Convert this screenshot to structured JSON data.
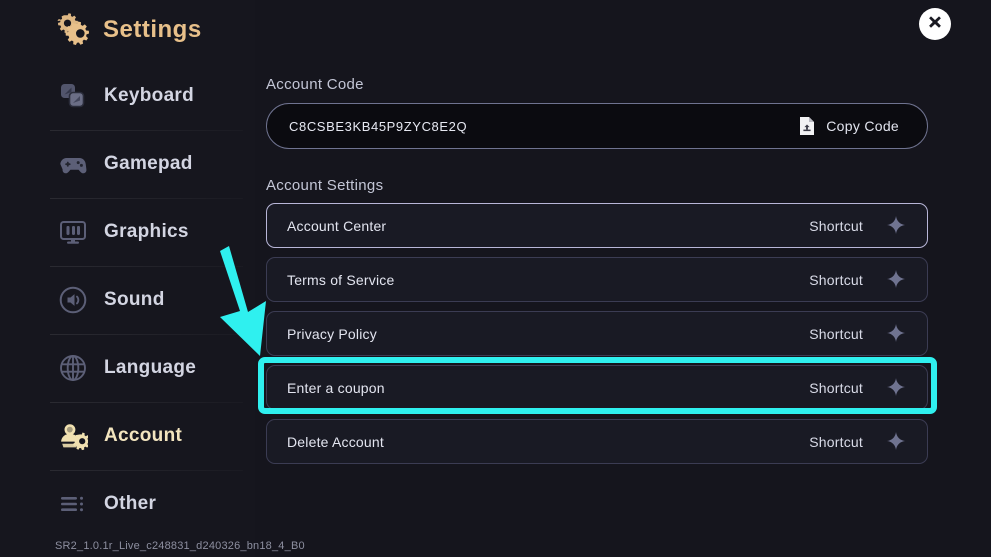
{
  "app": {
    "title": "Settings",
    "version": "SR2_1.0.1r_Live_c248831_d240326_bn18_4_B0",
    "accent_gold": "#e8c08a",
    "background": "#15151d",
    "highlight_cyan": "#2ff0ef"
  },
  "close_button": {
    "label": "Close",
    "icon": "close-icon"
  },
  "sidebar": {
    "items": [
      {
        "label": "Keyboard",
        "icon": "keyboard-icon",
        "active": false
      },
      {
        "label": "Gamepad",
        "icon": "gamepad-icon",
        "active": false
      },
      {
        "label": "Graphics",
        "icon": "graphics-icon",
        "active": false
      },
      {
        "label": "Sound",
        "icon": "sound-icon",
        "active": false
      },
      {
        "label": "Language",
        "icon": "language-icon",
        "active": false
      },
      {
        "label": "Account",
        "icon": "account-icon",
        "active": true
      },
      {
        "label": "Other",
        "icon": "other-icon",
        "active": false
      }
    ]
  },
  "main": {
    "account_code": {
      "label": "Account Code",
      "value": "C8CSBE3KB45P9ZYC8E2Q",
      "copy_label": "Copy Code",
      "copy_icon": "copy-document-icon"
    },
    "account_settings": {
      "label": "Account Settings",
      "rows": [
        {
          "label": "Account Center",
          "action": "Shortcut",
          "selected": true,
          "highlighted": false
        },
        {
          "label": "Terms of Service",
          "action": "Shortcut",
          "selected": false,
          "highlighted": false
        },
        {
          "label": "Privacy Policy",
          "action": "Shortcut",
          "selected": false,
          "highlighted": false
        },
        {
          "label": "Enter a coupon",
          "action": "Shortcut",
          "selected": false,
          "highlighted": true
        },
        {
          "label": "Delete Account",
          "action": "Shortcut",
          "selected": false,
          "highlighted": false
        }
      ]
    }
  }
}
